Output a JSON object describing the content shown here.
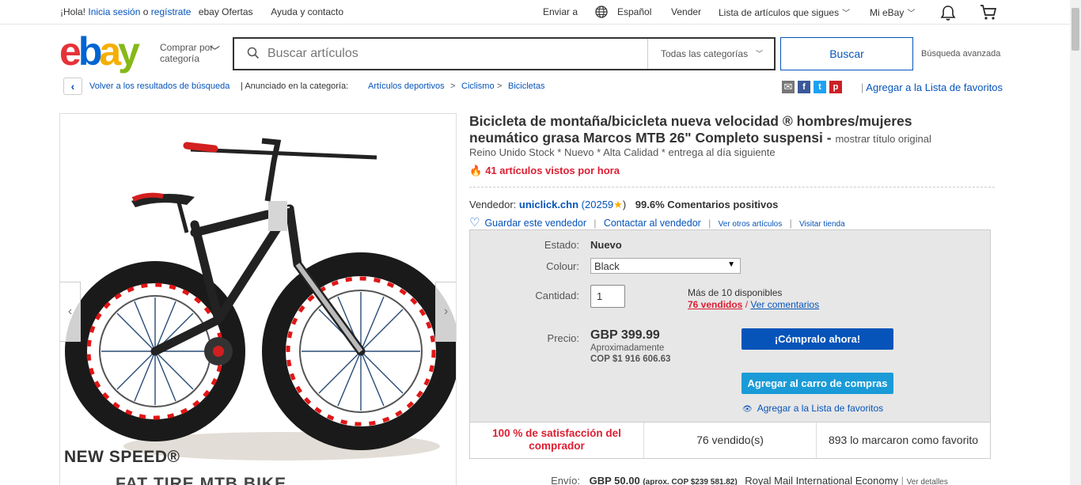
{
  "topbar": {
    "greeting": "¡Hola!",
    "signin": "Inicia sesión",
    "or": "o",
    "register": "regístrate",
    "deals": "ebay Ofertas",
    "help": "Ayuda y contacto",
    "ship_to": "Enviar a",
    "language": "Español",
    "sell": "Vender",
    "watchlist": "Lista de artículos que sigues",
    "my_ebay": "Mi eBay"
  },
  "header": {
    "logo": [
      "e",
      "b",
      "a",
      "y"
    ],
    "shop_by_category": "Comprar por categoría",
    "search_placeholder": "Buscar artículos",
    "all_categories": "Todas las categorías",
    "search_button": "Buscar",
    "advanced": "Búsqueda avanzada"
  },
  "breadcrumbs": {
    "back": "Volver a los resultados de búsqueda",
    "listed_in": "Anunciado en la categoría:",
    "items": [
      "Artículos deportivos",
      "Ciclismo",
      "Bicicletas"
    ],
    "separator": ">",
    "add_watchlist": "Agregar a la Lista de favoritos"
  },
  "share_icons": [
    {
      "name": "email-icon",
      "glyph": "✉",
      "color": "#777777"
    },
    {
      "name": "facebook-icon",
      "glyph": "f",
      "color": "#3b5998"
    },
    {
      "name": "twitter-icon",
      "glyph": "t",
      "color": "#1da1f2"
    },
    {
      "name": "pinterest-icon",
      "glyph": "p",
      "color": "#cb2027"
    }
  ],
  "image": {
    "caption_1": "NEW SPEED®",
    "caption_2": "FAT TIRE MTB BIKE"
  },
  "product": {
    "title": "Bicicleta de montaña/bicicleta nueva velocidad ® hombres/mujeres neumático grasa Marcos MTB 26\" Completo suspensi -",
    "show_original": "mostrar título original",
    "subtitle": "Reino Unido Stock * Nuevo * Alta Calidad * entrega al día siguiente",
    "hot": "41 artículos vistos por hora"
  },
  "seller": {
    "label": "Vendedor:",
    "name": "uniclick.chn",
    "score": "20259",
    "feedback": "99.6% Comentarios positivos",
    "save": "Guardar este vendedor",
    "contact": "Contactar al vendedor",
    "other_items": "Ver otros artículos",
    "store": "Visitar tienda"
  },
  "panel": {
    "condition_label": "Estado:",
    "condition": "Nuevo",
    "colour_label": "Colour:",
    "colour": "Black",
    "qty_label": "Cantidad:",
    "qty": "1",
    "available": "Más de 10 disponibles",
    "sold": "76 vendidos",
    "reviews": "Ver comentarios",
    "price_label": "Precio:",
    "price": "GBP 399.99",
    "approx_label": "Aproximadamente",
    "approx": "COP $1 916 606.63",
    "buy_now": "¡Cómpralo ahora!",
    "add_cart": "Agregar al carro de compras",
    "watch": "Agregar a la Lista de favoritos"
  },
  "stats": {
    "satisfaction": "100 % de satisfacción del comprador",
    "sold": "76 vendido(s)",
    "watchers": "893 lo marcaron como favorito"
  },
  "shipping": {
    "label": "Envío:",
    "price": "GBP 50.00",
    "approx": "(aprox. COP $239 581.82)",
    "method": "Royal Mail International Economy",
    "details": "Ver detalles"
  },
  "colors": {
    "link": "#0654ba",
    "buy": "#0654ba",
    "cart": "#1a9bd7",
    "hot": "#dd1e31"
  }
}
